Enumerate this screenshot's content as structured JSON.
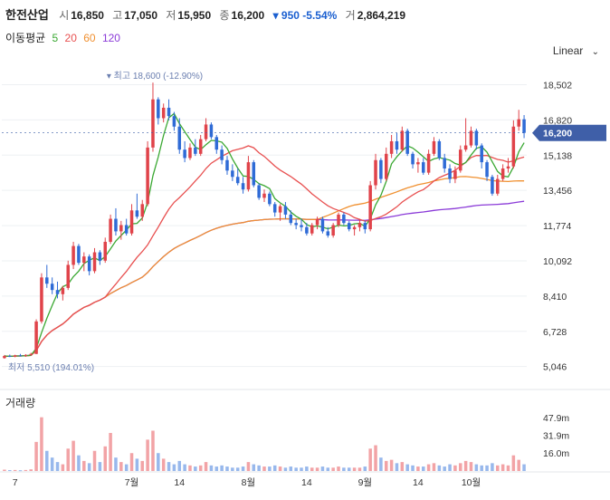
{
  "header": {
    "name": "한전산업",
    "open_label": "시",
    "open": "16,850",
    "high_label": "고",
    "high": "17,050",
    "low_label": "저",
    "low": "15,950",
    "close_label": "종",
    "close": "16,200",
    "change": "▾ 950 -5.54%",
    "volume_label": "거",
    "volume": "2,864,219"
  },
  "ma_legend": {
    "title": "이동평균",
    "ma5": "5",
    "ma20": "20",
    "ma60": "60",
    "ma120": "120"
  },
  "scale_selector": "Linear",
  "volume_title": "거래량",
  "colors": {
    "up": "#e0434a",
    "down": "#2f6bd6",
    "ma5": "#3aa832",
    "ma20": "#e85050",
    "ma60": "#f09030",
    "ma120": "#8b3bd8",
    "price_tag": "#3f5fa8"
  },
  "chart_data": {
    "type": "candlestick",
    "price_axis": {
      "ticks": [
        "18,502",
        "16,820",
        "15,138",
        "13,456",
        "11,774",
        "10,092",
        "8,410",
        "6,728",
        "5,046"
      ],
      "tick_values": [
        18502,
        16820,
        15138,
        13456,
        11774,
        10092,
        8410,
        6728,
        5046
      ],
      "range": [
        4600,
        19300
      ]
    },
    "volume_axis": {
      "ticks": [
        "47.9m",
        "31.9m",
        "16.0m"
      ],
      "tick_values": [
        47.9,
        31.9,
        16.0
      ],
      "range": [
        0,
        55
      ]
    },
    "x_ticks": [
      {
        "label": "7",
        "index": 2
      },
      {
        "label": "7월",
        "index": 24
      },
      {
        "label": "14",
        "index": 33
      },
      {
        "label": "8월",
        "index": 46
      },
      {
        "label": "14",
        "index": 57
      },
      {
        "label": "9월",
        "index": 68
      },
      {
        "label": "14",
        "index": 78
      },
      {
        "label": "10월",
        "index": 88
      }
    ],
    "current_price_label": "16,200",
    "current_price": 16200,
    "high_annotation": {
      "text": "▾ 최고 18,600 (-12.90%)",
      "value": 18600,
      "index": 28
    },
    "low_annotation": {
      "text": "최저 5,510 (194.01%)",
      "value": 5510,
      "index": 0
    },
    "candles": [
      [
        5450,
        5600,
        5420,
        5550,
        1.2
      ],
      [
        5550,
        5620,
        5500,
        5520,
        0.8
      ],
      [
        5520,
        5610,
        5490,
        5580,
        0.9
      ],
      [
        5580,
        5650,
        5540,
        5560,
        0.7
      ],
      [
        5560,
        5640,
        5510,
        5600,
        0.9
      ],
      [
        5600,
        5700,
        5560,
        5650,
        1.5
      ],
      [
        5650,
        7300,
        5640,
        7200,
        26
      ],
      [
        7200,
        9500,
        7100,
        9300,
        48
      ],
      [
        9300,
        9900,
        8800,
        9000,
        18
      ],
      [
        9000,
        9300,
        8500,
        8700,
        12
      ],
      [
        8700,
        9100,
        8300,
        8500,
        8
      ],
      [
        8500,
        8900,
        8200,
        8800,
        6
      ],
      [
        8800,
        10100,
        8700,
        9900,
        20
      ],
      [
        9900,
        11000,
        9700,
        10800,
        27
      ],
      [
        10800,
        10900,
        9900,
        10000,
        14
      ],
      [
        10000,
        10500,
        9600,
        10300,
        9
      ],
      [
        10300,
        10400,
        9400,
        9600,
        7
      ],
      [
        9600,
        10700,
        9500,
        10500,
        18
      ],
      [
        10500,
        10600,
        9900,
        10100,
        8
      ],
      [
        10100,
        11200,
        10000,
        11000,
        22
      ],
      [
        11000,
        12300,
        10900,
        12100,
        34
      ],
      [
        12100,
        12600,
        11300,
        11500,
        12
      ],
      [
        11500,
        12000,
        11100,
        11800,
        8
      ],
      [
        11800,
        12100,
        11300,
        11400,
        6
      ],
      [
        11400,
        12800,
        11300,
        12500,
        16
      ],
      [
        12500,
        13300,
        12100,
        12200,
        11
      ],
      [
        12200,
        13000,
        12000,
        12800,
        9
      ],
      [
        12800,
        15800,
        12700,
        15500,
        28
      ],
      [
        15500,
        18600,
        15300,
        17800,
        36
      ],
      [
        17800,
        17900,
        16600,
        16900,
        16
      ],
      [
        16900,
        17600,
        16700,
        17400,
        11
      ],
      [
        17400,
        17800,
        16800,
        17000,
        8
      ],
      [
        17000,
        17200,
        16300,
        16500,
        6
      ],
      [
        16500,
        16900,
        15200,
        15400,
        9
      ],
      [
        15400,
        15800,
        14800,
        15000,
        6
      ],
      [
        15000,
        15700,
        14900,
        15500,
        5
      ],
      [
        15500,
        15900,
        15100,
        15200,
        4
      ],
      [
        15200,
        16100,
        15100,
        15900,
        5
      ],
      [
        15900,
        16900,
        15800,
        16600,
        8
      ],
      [
        16600,
        16700,
        15900,
        16000,
        5
      ],
      [
        16000,
        16100,
        15200,
        15400,
        4
      ],
      [
        15400,
        15600,
        14700,
        14900,
        5
      ],
      [
        14900,
        15100,
        14200,
        14400,
        4
      ],
      [
        14400,
        14700,
        13900,
        14100,
        3
      ],
      [
        14100,
        14500,
        13700,
        13800,
        3
      ],
      [
        13800,
        14100,
        13300,
        13500,
        4
      ],
      [
        13500,
        15100,
        13400,
        14800,
        8
      ],
      [
        14800,
        14900,
        13600,
        13700,
        6
      ],
      [
        13700,
        13800,
        13000,
        13100,
        5
      ],
      [
        13100,
        13500,
        12900,
        13300,
        4
      ],
      [
        13300,
        13400,
        12700,
        12800,
        4
      ],
      [
        12800,
        12900,
        12200,
        12400,
        5
      ],
      [
        12400,
        12800,
        12000,
        12700,
        4
      ],
      [
        12700,
        12900,
        12100,
        12300,
        3
      ],
      [
        12300,
        12500,
        11800,
        11900,
        4
      ],
      [
        11900,
        12100,
        11600,
        11800,
        3
      ],
      [
        11800,
        12100,
        11500,
        11700,
        3
      ],
      [
        11700,
        11900,
        11300,
        11400,
        4
      ],
      [
        11400,
        11900,
        11300,
        11800,
        3
      ],
      [
        11800,
        12200,
        11600,
        12100,
        3
      ],
      [
        12100,
        12200,
        11400,
        11500,
        4
      ],
      [
        11500,
        11700,
        11200,
        11300,
        3
      ],
      [
        11300,
        11900,
        11200,
        11800,
        3
      ],
      [
        11800,
        12400,
        11700,
        12300,
        4
      ],
      [
        12300,
        12400,
        11800,
        11900,
        3
      ],
      [
        11900,
        12000,
        11500,
        11600,
        3
      ],
      [
        11600,
        11800,
        11300,
        11700,
        3
      ],
      [
        11700,
        12100,
        11500,
        11900,
        3
      ],
      [
        11900,
        12000,
        11400,
        11600,
        4
      ],
      [
        11600,
        13900,
        11500,
        13700,
        20
      ],
      [
        13700,
        15200,
        13500,
        14900,
        23
      ],
      [
        14900,
        15000,
        13800,
        14000,
        12
      ],
      [
        14000,
        15500,
        13900,
        15200,
        9
      ],
      [
        15200,
        16100,
        15000,
        15800,
        10
      ],
      [
        15800,
        16200,
        15200,
        15400,
        7
      ],
      [
        15400,
        16500,
        15300,
        16300,
        8
      ],
      [
        16300,
        16400,
        15100,
        15200,
        6
      ],
      [
        15200,
        15300,
        14500,
        14700,
        5
      ],
      [
        14700,
        15000,
        14300,
        14800,
        4
      ],
      [
        14800,
        15000,
        14200,
        14300,
        4
      ],
      [
        14300,
        15400,
        14200,
        15200,
        6
      ],
      [
        15200,
        16000,
        15100,
        15800,
        7
      ],
      [
        15800,
        15900,
        14900,
        15000,
        5
      ],
      [
        15000,
        15200,
        14300,
        14500,
        4
      ],
      [
        14500,
        14700,
        13800,
        14000,
        6
      ],
      [
        14000,
        14600,
        13800,
        14400,
        5
      ],
      [
        14400,
        15600,
        14300,
        15400,
        7
      ],
      [
        15400,
        16900,
        15300,
        15600,
        9
      ],
      [
        15600,
        16500,
        15500,
        16300,
        8
      ],
      [
        16300,
        16400,
        15400,
        15600,
        6
      ],
      [
        15600,
        15700,
        14500,
        14800,
        5
      ],
      [
        14800,
        14900,
        13900,
        14100,
        5
      ],
      [
        14100,
        14200,
        13200,
        13300,
        7
      ],
      [
        13300,
        14200,
        13200,
        14000,
        5
      ],
      [
        14000,
        14700,
        13900,
        14500,
        6
      ],
      [
        14500,
        15000,
        14300,
        14600,
        5
      ],
      [
        14600,
        16800,
        14500,
        16500,
        14
      ],
      [
        16500,
        17300,
        16300,
        16850,
        10
      ],
      [
        16850,
        17050,
        15950,
        16200,
        6
      ]
    ]
  }
}
